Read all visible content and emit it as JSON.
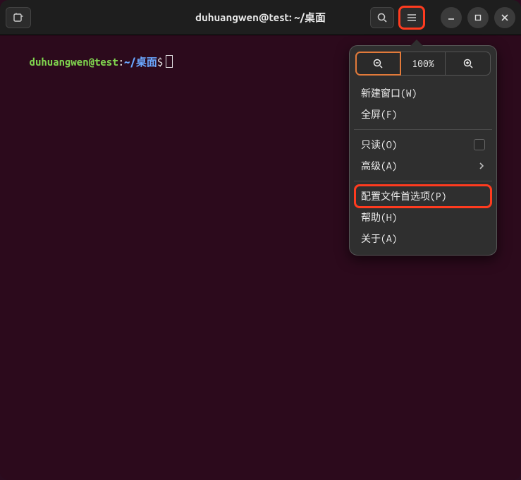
{
  "window": {
    "title": "duhuangwen@test: ~/桌面"
  },
  "titlebar_icons": {
    "new_tab": "new-tab-icon",
    "search": "search-icon",
    "menu": "hamburger-icon",
    "minimize": "minimize-icon",
    "maximize": "maximize-icon",
    "close": "close-icon"
  },
  "prompt": {
    "user_host": "duhuangwen@test",
    "sep": ":",
    "path": "~/桌面",
    "dollar": "$"
  },
  "popover": {
    "zoom_out_label": "-",
    "zoom_value": "100%",
    "zoom_in_label": "+",
    "items": {
      "new_window": "新建窗口(W)",
      "fullscreen": "全屏(F)",
      "readonly": "只读(O)",
      "advanced": "高级(A)",
      "preferences": "配置文件首选项(P)",
      "help": "帮助(H)",
      "about": "关于(A)"
    }
  }
}
